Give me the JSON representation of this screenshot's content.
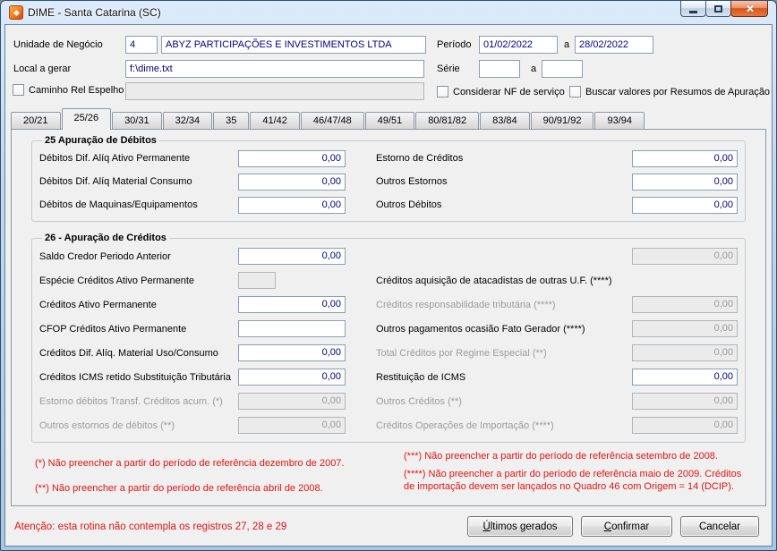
{
  "window": {
    "title": "DIME - Santa Catarina (SC)"
  },
  "header": {
    "unidade_label": "Unidade de Negócio",
    "unidade_code": "4",
    "unidade_nome": "ABYZ PARTICIPAÇÕES E INVESTIMENTOS LTDA",
    "periodo_label": "Período",
    "periodo_de": "01/02/2022",
    "periodo_sep": "a",
    "periodo_ate": "28/02/2022",
    "local_label": "Local a gerar",
    "local_valor": "f:\\dime.txt",
    "serie_label": "Série",
    "serie_de": "",
    "serie_sep": "a",
    "serie_ate": "",
    "chk_caminho": "Caminho Rel Espelho",
    "caminho_valor": "",
    "chk_nf_servico": "Considerar NF de serviço",
    "chk_resumos": "Buscar valores por Resumos de Apuração"
  },
  "tabs": {
    "items": [
      "20/21",
      "25/26",
      "30/31",
      "32/34",
      "35",
      "41/42",
      "46/47/48",
      "49/51",
      "80/81/82",
      "83/84",
      "90/91/92",
      "93/94"
    ],
    "active": "25/26"
  },
  "quadro25": {
    "titulo": "25 Apuração de Débitos",
    "rows": [
      {
        "l_label": "Débitos Dif. Alíq Ativo Permanente",
        "l_value": "0,00",
        "r_label": "Estorno de Créditos",
        "r_value": "0,00"
      },
      {
        "l_label": "Débitos Dif. Alíq Material Consumo",
        "l_value": "0,00",
        "r_label": "Outros Estornos",
        "r_value": "0,00"
      },
      {
        "l_label": "Débitos de Maquinas/Equipamentos",
        "l_value": "0,00",
        "r_label": "Outros Débitos",
        "r_value": "0,00"
      }
    ]
  },
  "quadro26": {
    "titulo": "26 - Apuração de Créditos",
    "rows": [
      {
        "l_label": "Saldo Credor Periodo Anterior",
        "l_value": "0,00",
        "r_label": "",
        "r_value": "0,00"
      },
      {
        "l_label": "Espécie Créditos Ativo Permanente",
        "l_value": "",
        "r_label": "Créditos aquisição de atacadistas de outras U.F. (****)",
        "r_value": ""
      },
      {
        "l_label": "Créditos Ativo Permanente",
        "l_value": "0,00",
        "r_label": "Créditos responsabilidade tributária (****)",
        "r_value": "0,00"
      },
      {
        "l_label": "CFOP Créditos Ativo Permanente",
        "l_value": "",
        "r_label": "Outros pagamentos ocasião Fato Gerador (****)",
        "r_value": "0,00"
      },
      {
        "l_label": "Créditos Dif. Alíq. Material Uso/Consumo",
        "l_value": "0,00",
        "r_label": "Total Créditos por Regime Especial (**)",
        "r_value": "0,00"
      },
      {
        "l_label": "Créditos ICMS retido Substituição Tributária",
        "l_value": "0,00",
        "r_label": "Restituição de ICMS",
        "r_value": "0,00"
      },
      {
        "l_label": "Estorno débitos Transf. Créditos acum. (*)",
        "l_value": "0,00",
        "r_label": "Outros Créditos (**)",
        "r_value": "0,00"
      },
      {
        "l_label": "Outros estornos de débitos (**)",
        "l_value": "0,00",
        "r_label": "Créditos Operações de Importação (****)",
        "r_value": "0,00"
      }
    ]
  },
  "footnotes": {
    "n1": "(*) Não preencher a partir do período de referência dezembro de 2007.",
    "n2": "(**) Não preencher a partir do período de referência abril de 2008.",
    "n3": "(***) Não preencher a partir do período de referência setembro de 2008.",
    "n4": "(****) Não preencher a partir do período de referência maio de 2009. Créditos de importação devem ser lançados no Quadro 46 com Origem = 14 (DCIP)."
  },
  "footer": {
    "atencao": "Atenção: esta rotina não contempla os registros 27, 28 e 29",
    "btn_ultimos": "Últimos gerados",
    "btn_confirmar": "Confirmar",
    "btn_cancelar": "Cancelar"
  }
}
